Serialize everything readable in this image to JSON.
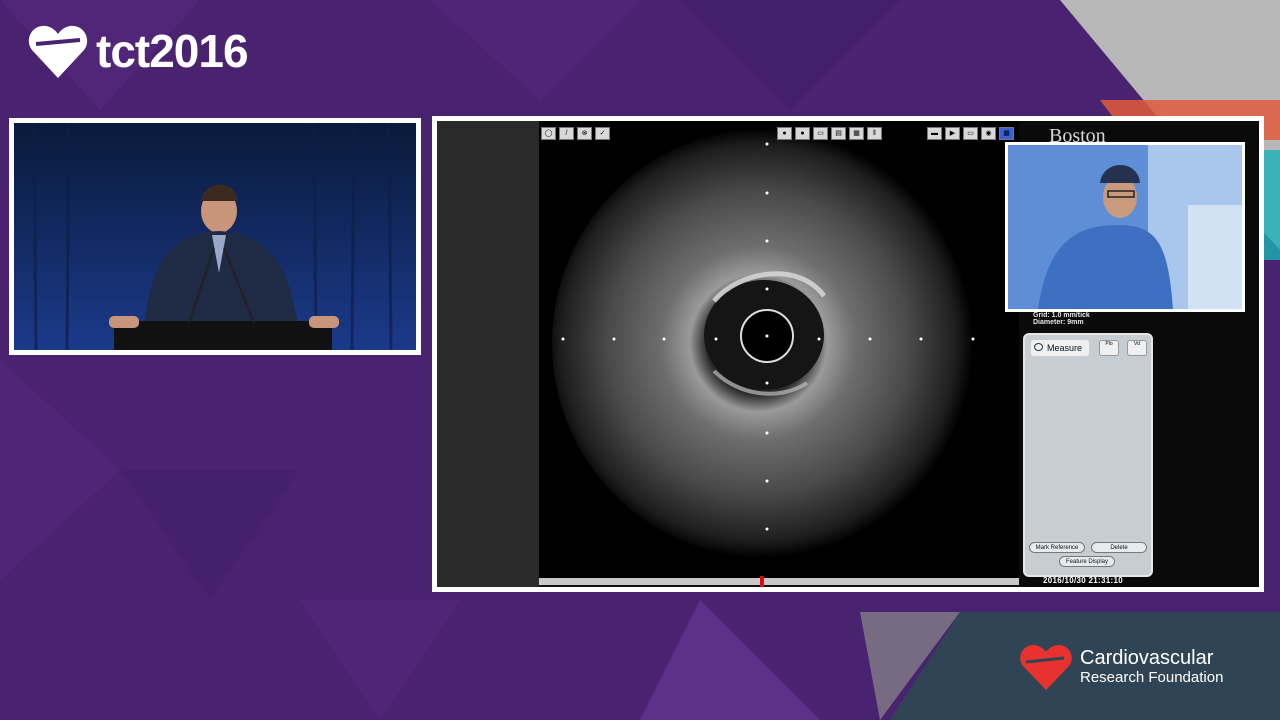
{
  "event_logo": {
    "text": "tct2016",
    "heart_color": "#ffffff"
  },
  "speaker_panel": {
    "label": ""
  },
  "ivus": {
    "brand_text": "Boston",
    "grid_line": "Grid: 1.0 mm/tick",
    "diameter_line": "Diameter: 9mm",
    "measure_tab": {
      "label": "Measure"
    },
    "measure_mini_tabs": [
      {
        "label": "Plo"
      },
      {
        "label": "Vd"
      }
    ],
    "buttons": {
      "mark_reference": "Mark Reference",
      "delete": "Delete",
      "feature_display": "Feature Display"
    },
    "timestamp": "2016/10/30 21:31:10",
    "scrub_position": 0.46
  },
  "footer_logo": {
    "line1": "Cardiovascular",
    "line2": "Research Foundation",
    "heart_color": "#e8322e"
  },
  "colors": {
    "background": "#4a2370",
    "accent": "#e8322e",
    "scrub_marker": "#d01010"
  }
}
